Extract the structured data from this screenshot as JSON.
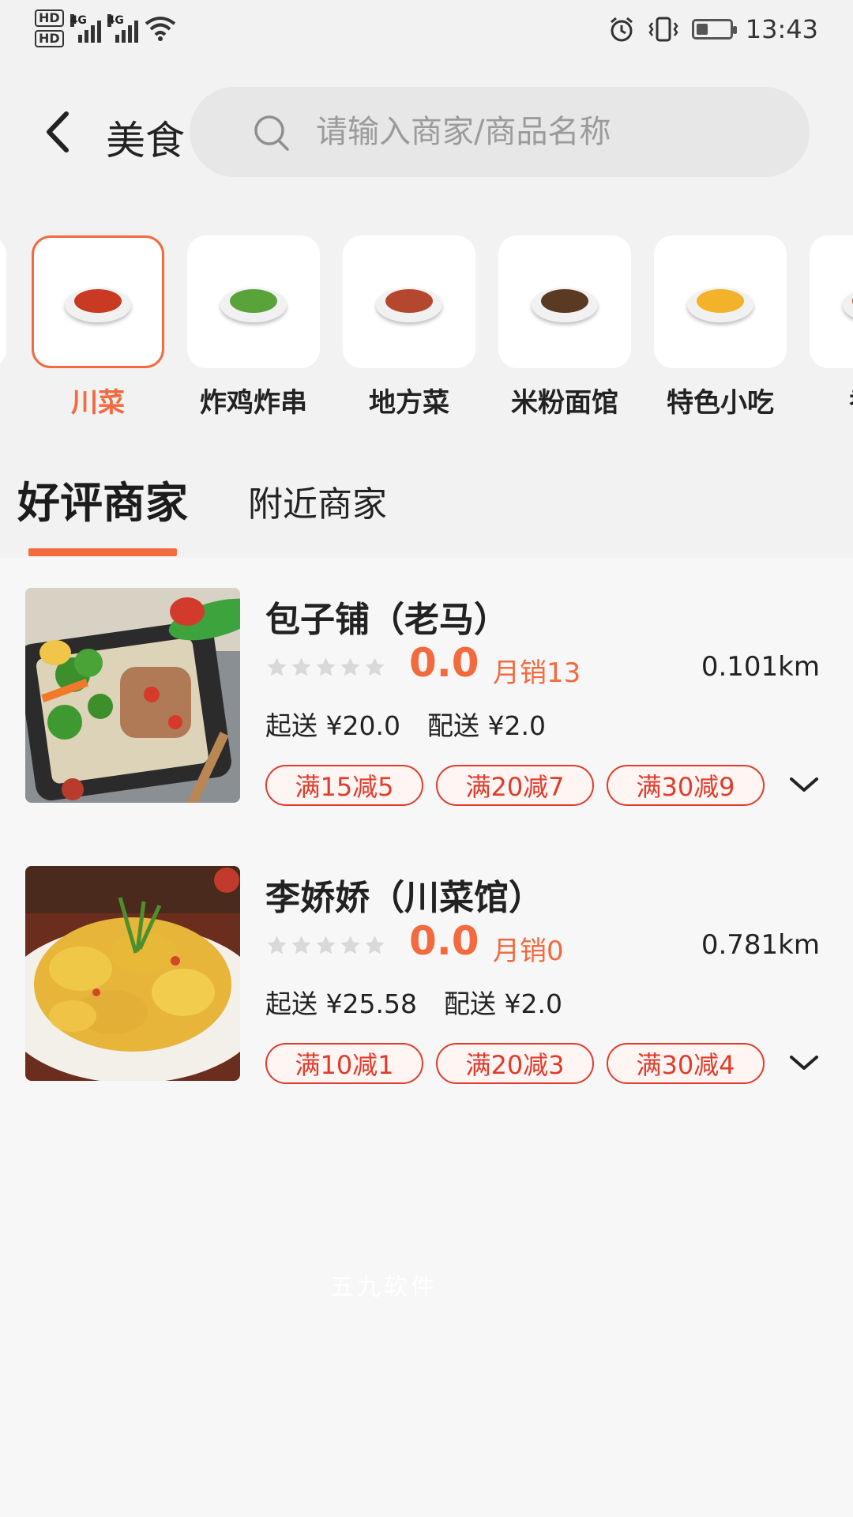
{
  "status_bar": {
    "hd1": "HD",
    "hd2": "HD",
    "sig1": "4G",
    "sig2": "4G",
    "time": "13:43",
    "battery_level": 0.35
  },
  "header": {
    "title": "美食",
    "search_placeholder": "请输入商家/商品名称"
  },
  "categories": [
    {
      "label": "川菜",
      "active": true,
      "icon": "sichuan-dish-icon",
      "food_color": "#c93a22"
    },
    {
      "label": "炸鸡炸串",
      "active": false,
      "icon": "skewers-icon",
      "food_color": "#5aa33a"
    },
    {
      "label": "地方菜",
      "active": false,
      "icon": "roast-meat-icon",
      "food_color": "#b5472f"
    },
    {
      "label": "米粉面馆",
      "active": false,
      "icon": "noodles-icon",
      "food_color": "#5b3a23"
    },
    {
      "label": "特色小吃",
      "active": false,
      "icon": "fries-icon",
      "food_color": "#f2b32a"
    },
    {
      "label": "香锅",
      "active": false,
      "icon": "hot-pot-icon",
      "food_color": "#b44a2d"
    }
  ],
  "tabs": [
    {
      "label": "好评商家",
      "active": true
    },
    {
      "label": "附近商家",
      "active": false
    }
  ],
  "shops": [
    {
      "name": "包子铺（老马）",
      "rating": "0.0",
      "sales": "月销13",
      "distance": "0.101km",
      "min_order": "起送 ¥20.0",
      "delivery_fee": "配送 ¥2.0",
      "promos": [
        "满15减5",
        "满20减7",
        "满30减9"
      ],
      "image": "bento-box-photo"
    },
    {
      "name": "李娇娇（川菜馆）",
      "rating": "0.0",
      "sales": "月销0",
      "distance": "0.781km",
      "min_order": "起送 ¥25.58",
      "delivery_fee": "配送 ¥2.0",
      "promos": [
        "满10减1",
        "满20减3",
        "满30减4"
      ],
      "image": "fried-chicken-photo"
    }
  ],
  "watermark": "五九软件",
  "colors": {
    "accent": "#f26a3d",
    "promo_border": "#e03b2c"
  }
}
